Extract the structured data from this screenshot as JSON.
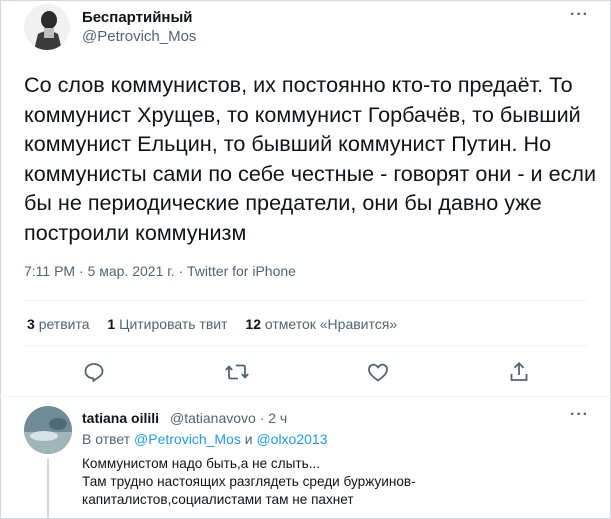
{
  "tweet": {
    "author_name": "Беспартийный",
    "author_handle": "@Petrovich_Mos",
    "text": "Со слов коммунистов, их постоянно кто-то предаёт. То коммунист Хрущев, то коммунист Горбачёв, то бывший коммунист Ельцин, то бывший коммунист Путин. Но коммунисты сами по себе честные - говорят они - и если бы не периодические предатели, они бы давно уже построили коммунизм",
    "time": "7:11 PM",
    "date": "5 мар. 2021 г.",
    "source": "Twitter for iPhone",
    "separator": "·"
  },
  "stats": {
    "retweets_count": "3",
    "retweets_label": "ретвита",
    "quotes_count": "1",
    "quotes_label": "Цитировать твит",
    "likes_count": "12",
    "likes_label": "отметок «Нравится»"
  },
  "actions": [
    "reply-icon",
    "retweet-icon",
    "like-icon",
    "share-icon"
  ],
  "reply": {
    "author_name": "tatiana oilili",
    "author_handle": "@tatianavovo · 2 ч",
    "reply_prefix": "В ответ",
    "reply_to_1": "@Petrovich_Mos",
    "reply_and": "и",
    "reply_to_2": "@olxo2013",
    "text_line_1": "Коммунистом надо быть,а не слыть...",
    "text_line_2": "Там трудно настоящих разглядеть среди буржуинов-капиталистов,социалистами там не пахнет"
  },
  "more_label": "···",
  "colors": {
    "link": "#1d9bf0",
    "secondary": "#536471",
    "primary": "#0f1419"
  }
}
